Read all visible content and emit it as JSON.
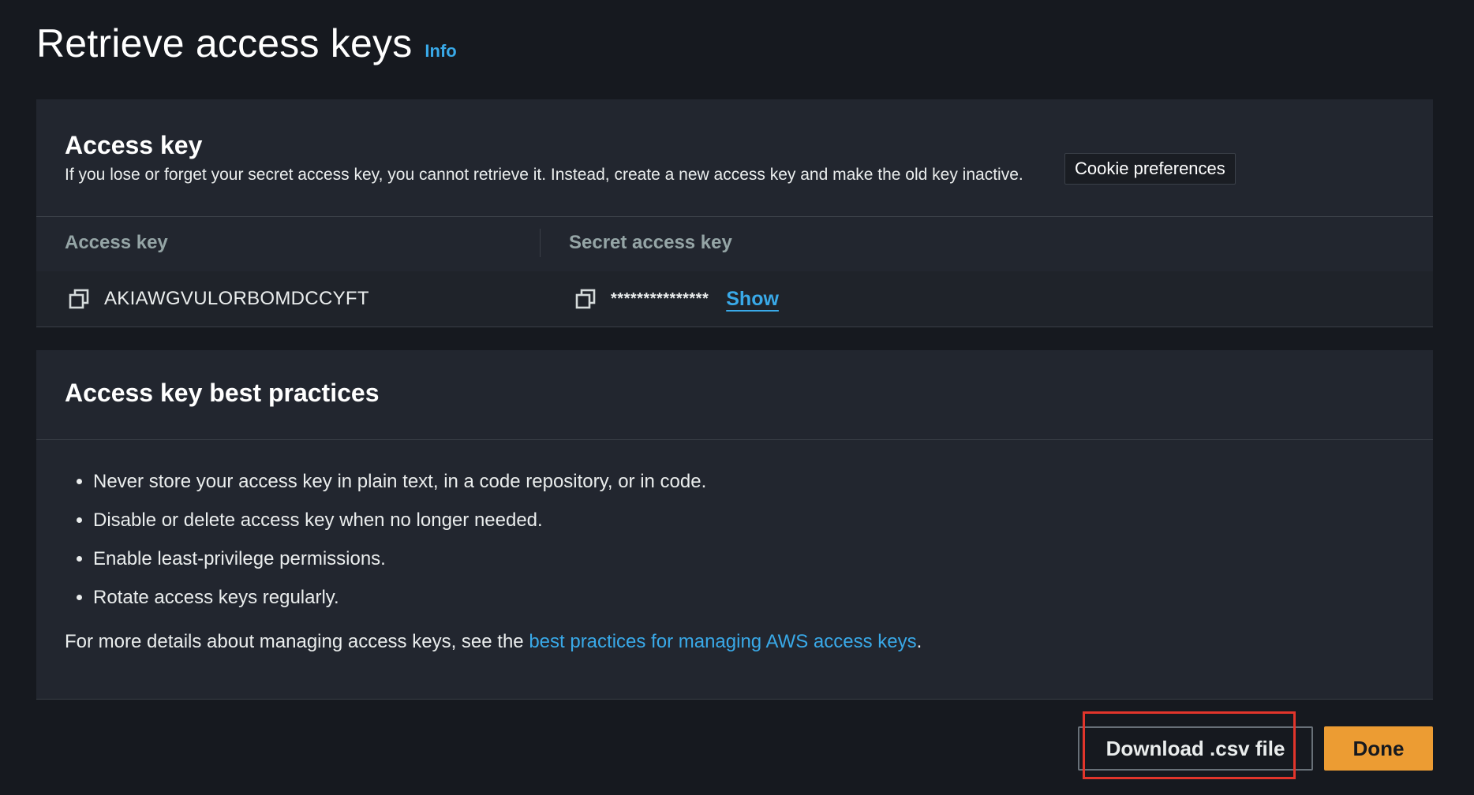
{
  "page": {
    "title": "Retrieve access keys",
    "info_label": "Info"
  },
  "access_key_card": {
    "title": "Access key",
    "description": "If you lose or forget your secret access key, you cannot retrieve it. Instead, create a new access key and make the old key inactive.",
    "tooltip": "Cookie preferences",
    "table": {
      "columns": [
        "Access key",
        "Secret access key"
      ],
      "access_key_value": "AKIAWGVULORBOMDCCYFT",
      "secret_masked": "***************",
      "show_label": "Show",
      "copy_icon": "copy-icon"
    }
  },
  "best_practices_card": {
    "title": "Access key best practices",
    "items": [
      "Never store your access key in plain text, in a code repository, or in code.",
      "Disable or delete access key when no longer needed.",
      "Enable least-privilege permissions.",
      "Rotate access keys regularly."
    ],
    "more_prefix": "For more details about managing access keys, see the ",
    "more_link": "best practices for managing AWS access keys",
    "more_suffix": "."
  },
  "actions": {
    "download_label": "Download .csv file",
    "done_label": "Done"
  },
  "colors": {
    "background": "#16191f",
    "card": "#22262f",
    "link": "#39a9e8",
    "primary_button": "#ec9c33",
    "highlight": "#e2352b"
  }
}
